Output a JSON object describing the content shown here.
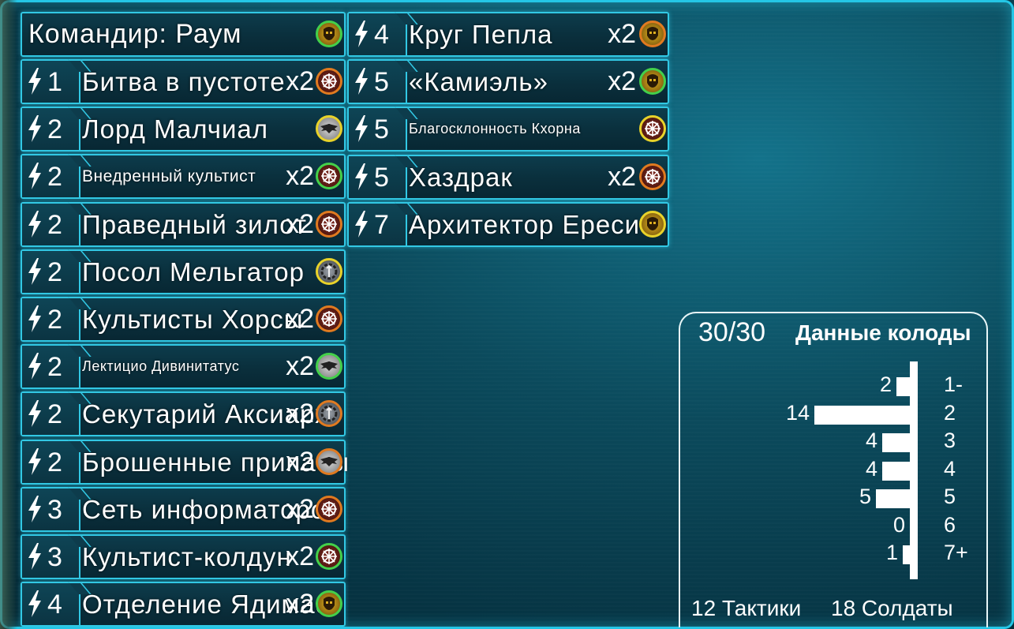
{
  "commander": {
    "label": "Командир: Раум",
    "faction": "ork",
    "faction_ring": "green"
  },
  "cards": [
    {
      "cost": "1",
      "name": "Битва в пустоте",
      "count": "x2",
      "faction": "chaos",
      "ring": "orange"
    },
    {
      "cost": "2",
      "name": "Лорд Малчиал",
      "count": "",
      "faction": "imperial",
      "ring": "yellow"
    },
    {
      "cost": "2",
      "name": "Внедренный культист",
      "count": "x2",
      "faction": "chaos",
      "ring": "green"
    },
    {
      "cost": "2",
      "name": "Праведный зилот",
      "count": "x2",
      "faction": "chaos",
      "ring": "orange"
    },
    {
      "cost": "2",
      "name": "Посол Мельгатор",
      "count": "",
      "faction": "mech",
      "ring": "yellow"
    },
    {
      "cost": "2",
      "name": "Культисты Хорсы",
      "count": "x2",
      "faction": "chaos",
      "ring": "orange"
    },
    {
      "cost": "2",
      "name": "Лектицио Дивинитатус",
      "count": "x2",
      "faction": "imperial",
      "ring": "green"
    },
    {
      "cost": "2",
      "name": "Секутарий Аксиарх",
      "count": "x2",
      "faction": "mech",
      "ring": "orange"
    },
    {
      "cost": "2",
      "name": "Брошенные припасы",
      "count": "x2",
      "faction": "imperial",
      "ring": "orange"
    },
    {
      "cost": "3",
      "name": "Сеть информаторов",
      "count": "x2",
      "faction": "chaos",
      "ring": "orange"
    },
    {
      "cost": "3",
      "name": "Культист-колдун",
      "count": "x2",
      "faction": "chaos",
      "ring": "green"
    },
    {
      "cost": "4",
      "name": "Отделение Ядимас",
      "count": "x2",
      "faction": "ork",
      "ring": "green"
    },
    {
      "cost": "4",
      "name": "Круг Пепла",
      "count": "x2",
      "faction": "ork",
      "ring": "orange"
    },
    {
      "cost": "5",
      "name": "«Камиэль»",
      "count": "x2",
      "faction": "ork",
      "ring": "green"
    },
    {
      "cost": "5",
      "name": "Благосклонность Кхорна",
      "count": "",
      "faction": "chaos",
      "ring": "yellow"
    },
    {
      "cost": "5",
      "name": "Хаздрак",
      "count": "x2",
      "faction": "chaos",
      "ring": "orange"
    },
    {
      "cost": "7",
      "name": "Архитектор Ереси",
      "count": "",
      "faction": "ork",
      "ring": "yellow"
    }
  ],
  "deck": {
    "total": "30/30",
    "title": "Данные колоды",
    "curve": [
      {
        "cost": "1-",
        "count": 2
      },
      {
        "cost": "2",
        "count": 14
      },
      {
        "cost": "3",
        "count": 4
      },
      {
        "cost": "4",
        "count": 4
      },
      {
        "cost": "5",
        "count": 5
      },
      {
        "cost": "6",
        "count": 0
      },
      {
        "cost": "7+",
        "count": 1
      }
    ],
    "tactics": "12 Тактики",
    "soldiers": "18 Солдаты"
  }
}
